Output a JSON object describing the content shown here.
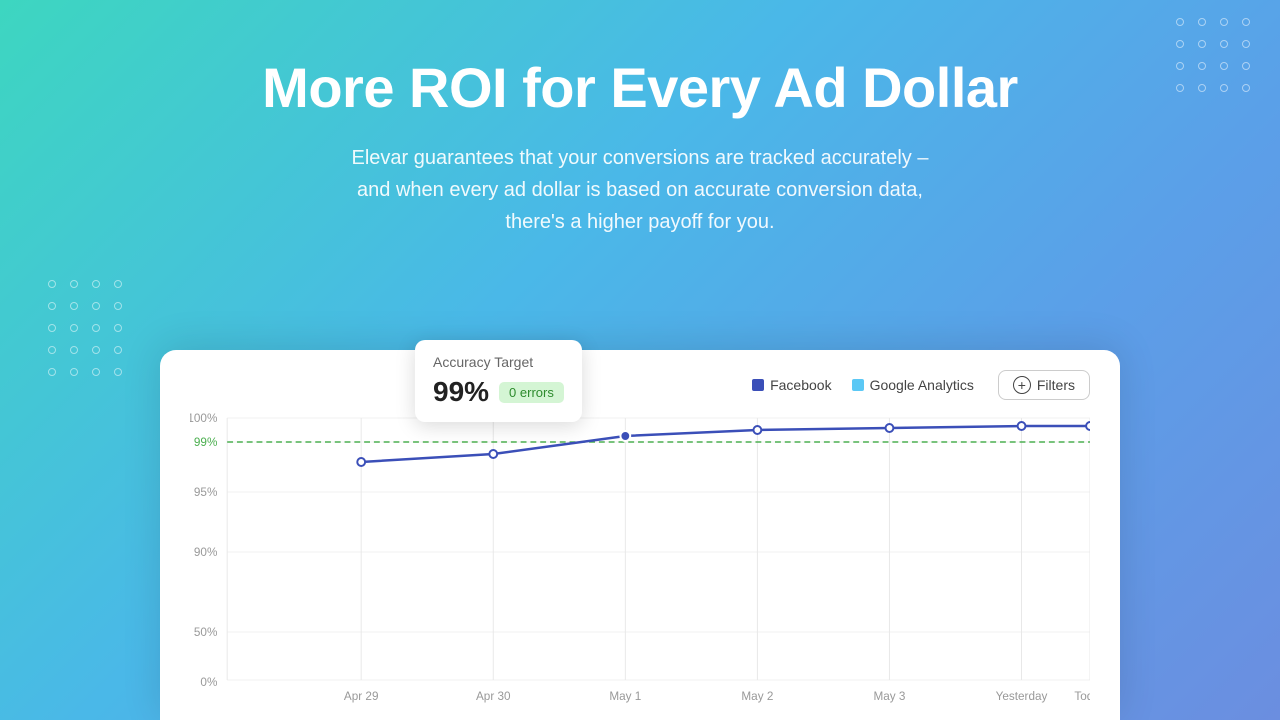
{
  "hero": {
    "title": "More ROI for Every Ad Dollar",
    "subtitle": "Elevar guarantees that your conversions are tracked accurately –\nand when every ad dollar is based on accurate conversion data,\nthere's a higher payoff for you."
  },
  "legend": {
    "facebook_label": "Facebook",
    "facebook_color": "#3b4fb8",
    "google_analytics_label": "Google Analytics",
    "google_analytics_color": "#5bc8f5"
  },
  "filters_button": "Filters",
  "tooltip": {
    "title": "Accuracy Target",
    "value": "99%",
    "badge": "0 errors"
  },
  "chart": {
    "y_labels": [
      "100%",
      "99%",
      "95%",
      "90%",
      "50%",
      "0%"
    ],
    "x_labels": [
      "Apr 29",
      "Apr 30",
      "May 1",
      "May 2",
      "May 3",
      "Yesterday",
      "Today"
    ]
  },
  "dot_grid": {
    "count_top_right": 16,
    "count_left": 20
  }
}
